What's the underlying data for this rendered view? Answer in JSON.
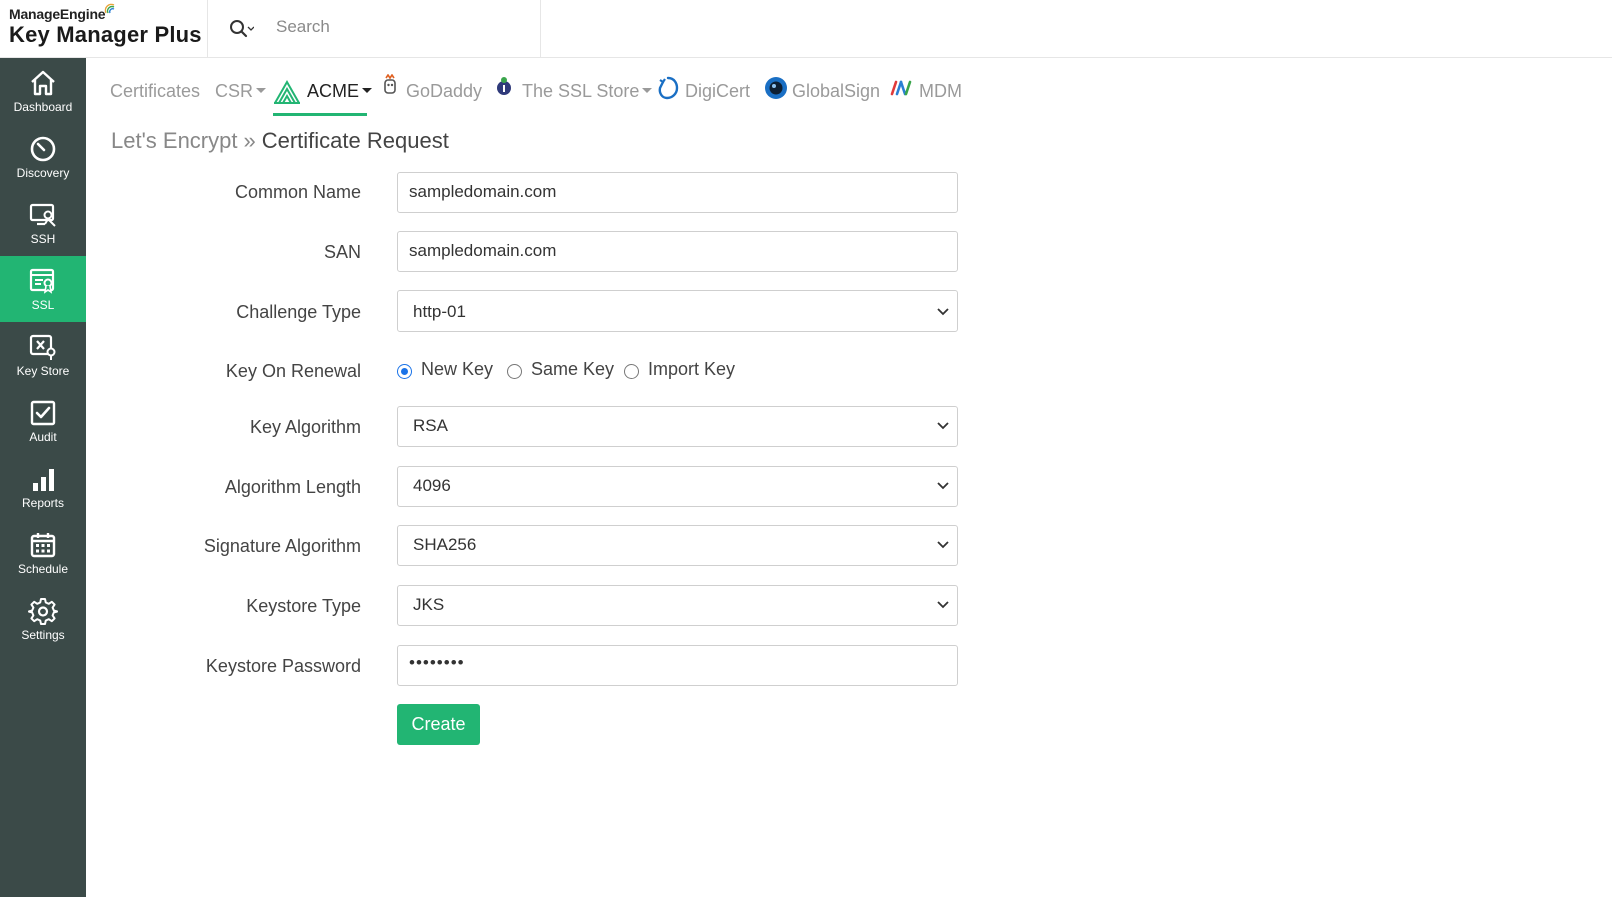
{
  "header": {
    "brand_top": "ManageEngine",
    "brand_name": "Key Manager Plus",
    "search_placeholder": "Search"
  },
  "sidebar": {
    "items": [
      {
        "label": "Dashboard",
        "icon": "home-icon"
      },
      {
        "label": "Discovery",
        "icon": "discovery-icon"
      },
      {
        "label": "SSH",
        "icon": "ssh-icon"
      },
      {
        "label": "SSL",
        "icon": "ssl-icon",
        "active": true
      },
      {
        "label": "Key Store",
        "icon": "key-store-icon"
      },
      {
        "label": "Audit",
        "icon": "audit-icon"
      },
      {
        "label": "Reports",
        "icon": "reports-icon"
      },
      {
        "label": "Schedule",
        "icon": "schedule-icon"
      },
      {
        "label": "Settings",
        "icon": "settings-icon"
      }
    ]
  },
  "tabs": [
    {
      "label": "Certificates"
    },
    {
      "label": "CSR",
      "dropdown": true
    },
    {
      "label": "ACME",
      "dropdown": true,
      "active": true
    },
    {
      "label": "GoDaddy"
    },
    {
      "label": "The SSL Store",
      "dropdown": true
    },
    {
      "label": "DigiCert"
    },
    {
      "label": "GlobalSign"
    },
    {
      "label": "MDM"
    }
  ],
  "breadcrumb": {
    "parent": "Let's Encrypt",
    "separator": "»",
    "current": "Certificate Request"
  },
  "form": {
    "common_name": {
      "label": "Common Name",
      "value": "sampledomain.com"
    },
    "san": {
      "label": "SAN",
      "value": "sampledomain.com"
    },
    "challenge_type": {
      "label": "Challenge Type",
      "value": "http-01"
    },
    "key_on_renewal": {
      "label": "Key On Renewal",
      "options": [
        "New Key",
        "Same Key",
        "Import Key"
      ],
      "selected": "New Key"
    },
    "key_algorithm": {
      "label": "Key Algorithm",
      "value": "RSA"
    },
    "algorithm_length": {
      "label": "Algorithm Length",
      "value": "4096"
    },
    "signature_algorithm": {
      "label": "Signature Algorithm",
      "value": "SHA256"
    },
    "keystore_type": {
      "label": "Keystore Type",
      "value": "JKS"
    },
    "keystore_password": {
      "label": "Keystore Password",
      "value": "••••••••"
    },
    "create_label": "Create"
  },
  "colors": {
    "accent": "#22b573",
    "sidebar_bg": "#3b4a48",
    "radio_selected": "#1a73e8"
  }
}
